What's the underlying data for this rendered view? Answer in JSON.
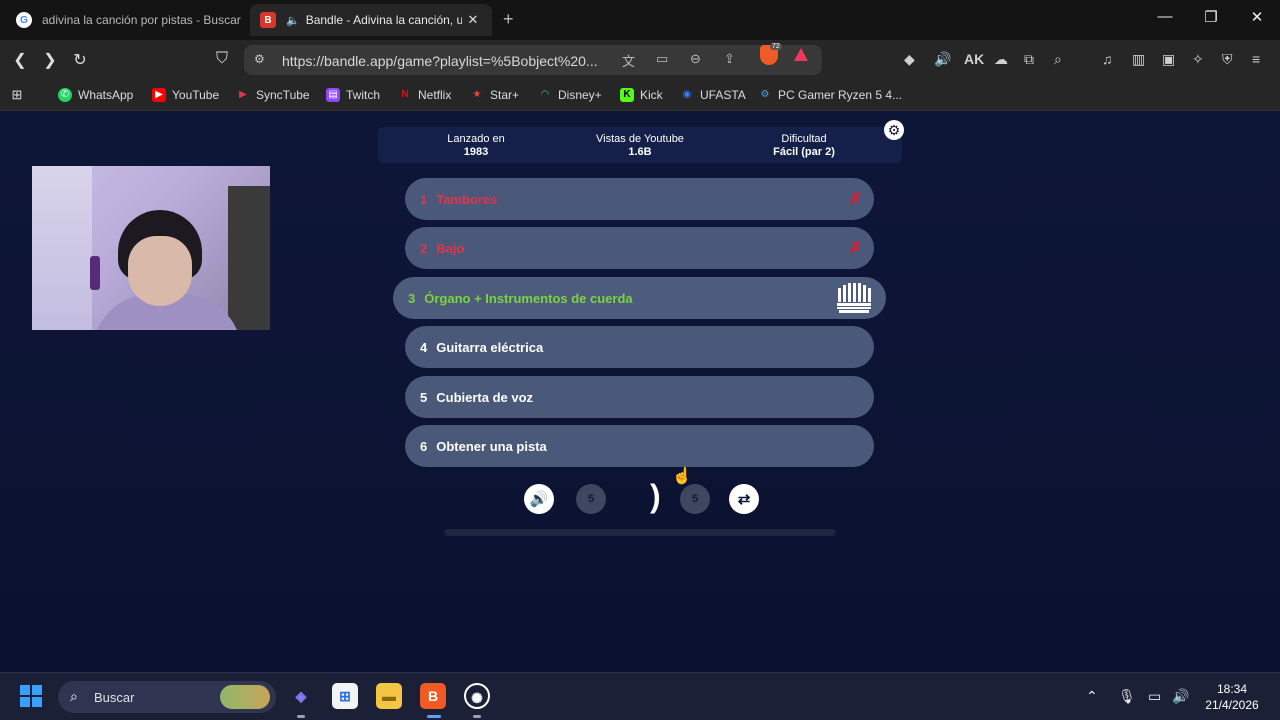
{
  "browser": {
    "tabs": [
      {
        "title": "adivina la canción por pistas - Buscar"
      },
      {
        "title": "Bandle - Adivina la canción, u"
      }
    ],
    "url": "https://bandle.app/game?playlist=%5Bobject%20...",
    "shields_count": "72",
    "bookmarks": [
      "WhatsApp",
      "YouTube",
      "SyncTube",
      "Twitch",
      "Netflix",
      "Star+",
      "Disney+",
      "Kick",
      "UFASTA",
      "PC Gamer Ryzen 5 4..."
    ]
  },
  "game": {
    "info": [
      {
        "label": "Lanzado en",
        "value": "1983"
      },
      {
        "label": "Vistas de Youtube",
        "value": "1.6B"
      },
      {
        "label": "Dificultad",
        "value": "Fácil (par 2)"
      }
    ],
    "steps": [
      {
        "num": "1",
        "label": "Tambores",
        "state": "wrong"
      },
      {
        "num": "2",
        "label": "Bajo",
        "state": "wrong"
      },
      {
        "num": "3",
        "label": "Órgano + Instrumentos de cuerda",
        "state": "current"
      },
      {
        "num": "4",
        "label": "Guitarra eléctrica",
        "state": "normal"
      },
      {
        "num": "5",
        "label": "Cubierta de voz",
        "state": "normal"
      },
      {
        "num": "6",
        "label": "Obtener una pista",
        "state": "normal"
      }
    ],
    "rewind_label": "5",
    "forward_label": "5",
    "progress": 0
  },
  "taskbar": {
    "search_placeholder": "Buscar",
    "time": "18:34",
    "date": "21/4/2026"
  },
  "colors": {
    "page_bg": "#0d1333",
    "row_bg": "#4a5879",
    "wrong": "#e0344d",
    "current": "#7bd43d"
  }
}
